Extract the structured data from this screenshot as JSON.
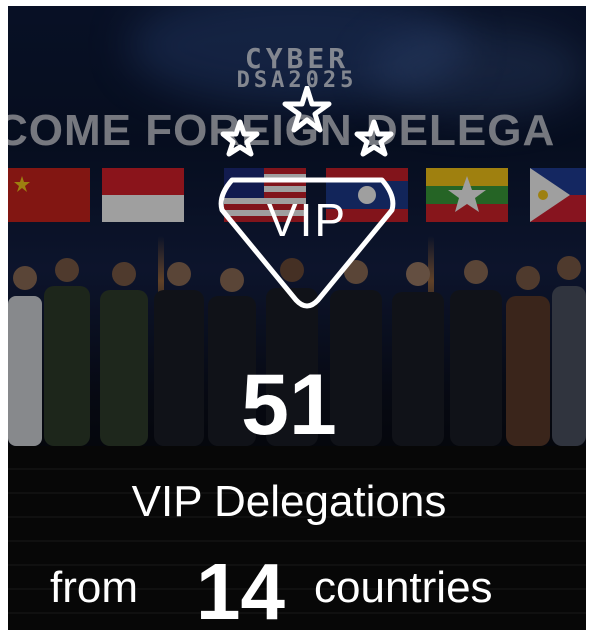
{
  "backdrop": {
    "logo_line1": "CYBER",
    "logo_line2": "DSA2025",
    "banner_text": "COME FOREIGN DELEGA"
  },
  "vip_badge": {
    "label": "VIP"
  },
  "stats": {
    "delegations_count": "51",
    "delegations_label": "VIP Delegations",
    "from_label": "from",
    "countries_count": "14",
    "countries_label": "countries"
  }
}
